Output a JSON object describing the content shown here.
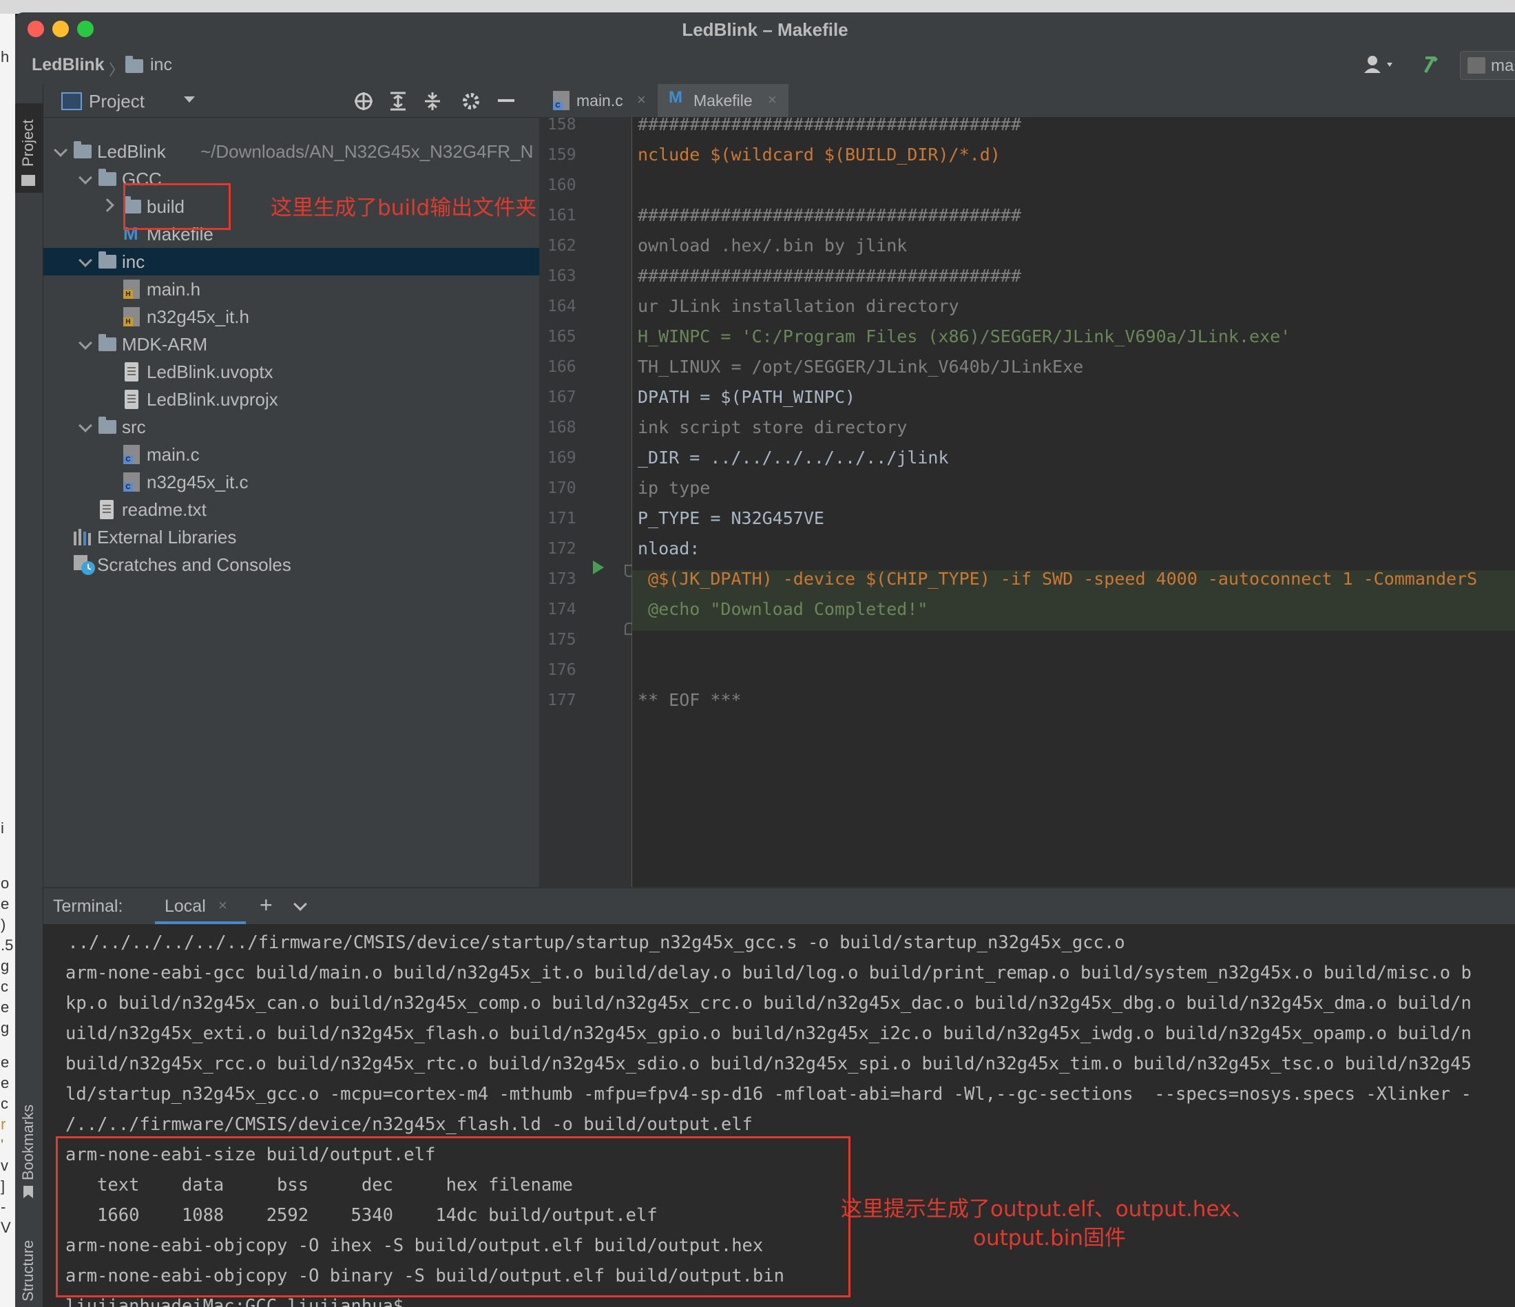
{
  "window": {
    "title": "LedBlink – Makefile",
    "breadcrumb_project": "LedBlink",
    "breadcrumb_folder": "inc",
    "right_button_partial": "ma"
  },
  "side_tabs": {
    "project": "Project",
    "bookmarks": "Bookmarks",
    "structure": "Structure"
  },
  "project_panel": {
    "title": "Project",
    "tree": [
      {
        "label": "LedBlink",
        "path": "~/Downloads/AN_N32G45x_N32G4FR_N"
      },
      {
        "label": "GCC"
      },
      {
        "label": "build"
      },
      {
        "label": "Makefile"
      },
      {
        "label": "inc"
      },
      {
        "label": "main.h"
      },
      {
        "label": "n32g45x_it.h"
      },
      {
        "label": "MDK-ARM"
      },
      {
        "label": "LedBlink.uvoptx"
      },
      {
        "label": "LedBlink.uvprojx"
      },
      {
        "label": "src"
      },
      {
        "label": "main.c"
      },
      {
        "label": "n32g45x_it.c"
      },
      {
        "label": "readme.txt"
      },
      {
        "label": "External Libraries"
      },
      {
        "label": "Scratches and Consoles"
      }
    ]
  },
  "editor": {
    "tabs": [
      {
        "label": "main.c"
      },
      {
        "label": "Makefile"
      }
    ],
    "line_numbers": [
      "158",
      "159",
      "160",
      "161",
      "162",
      "163",
      "164",
      "165",
      "166",
      "167",
      "168",
      "169",
      "170",
      "171",
      "172",
      "173",
      "174",
      "175",
      "176",
      "177"
    ],
    "lines": [
      "#####################################",
      "nclude $(wildcard $(BUILD_DIR)/*.d)",
      "",
      "#####################################",
      "ownload .hex/.bin by jlink",
      "#####################################",
      "ur JLink installation directory",
      "H_WINPC = 'C:/Program Files (x86)/SEGGER/JLink_V690a/JLink.exe'",
      "TH_LINUX = /opt/SEGGER/JLink_V640b/JLinkExe",
      "DPATH = $(PATH_WINPC)",
      "ink script store directory",
      "_DIR = ../../../../../../jlink",
      "ip type",
      "P_TYPE = N32G457VE",
      "nload:",
      " @$(JK_DPATH) -device $(CHIP_TYPE) -if SWD -speed 4000 -autoconnect 1 -CommanderS",
      " @echo \"Download Completed!\"",
      "",
      "",
      "** EOF ***"
    ]
  },
  "terminal": {
    "label": "Terminal:",
    "tab": "Local",
    "lines": [
      " ../../../../../../firmware/CMSIS/device/startup/startup_n32g45x_gcc.s -o build/startup_n32g45x_gcc.o",
      "arm-none-eabi-gcc build/main.o build/n32g45x_it.o build/delay.o build/log.o build/print_remap.o build/system_n32g45x.o build/misc.o b",
      "kp.o build/n32g45x_can.o build/n32g45x_comp.o build/n32g45x_crc.o build/n32g45x_dac.o build/n32g45x_dbg.o build/n32g45x_dma.o build/n",
      "uild/n32g45x_exti.o build/n32g45x_flash.o build/n32g45x_gpio.o build/n32g45x_i2c.o build/n32g45x_iwdg.o build/n32g45x_opamp.o build/n",
      "build/n32g45x_rcc.o build/n32g45x_rtc.o build/n32g45x_sdio.o build/n32g45x_spi.o build/n32g45x_tim.o build/n32g45x_tsc.o build/n32g45",
      "ld/startup_n32g45x_gcc.o -mcpu=cortex-m4 -mthumb -mfpu=fpv4-sp-d16 -mfloat-abi=hard -Wl,--gc-sections  --specs=nosys.specs -Xlinker -",
      "/../../firmware/CMSIS/device/n32g45x_flash.ld -o build/output.elf",
      "arm-none-eabi-size build/output.elf",
      "   text    data     bss     dec     hex filename",
      "   1660    1088    2592    5340    14dc build/output.elf",
      "arm-none-eabi-objcopy -O ihex -S build/output.elf build/output.hex",
      "arm-none-eabi-objcopy -O binary -S build/output.elf build/output.bin",
      "liujianhuadeiMac:GCC liujianhua$"
    ]
  },
  "annotations": {
    "build_note": "这里生成了build输出文件夹",
    "output_note_1": "这里提示生成了output.elf、output.hex、",
    "output_note_2": "output.bin固件"
  },
  "left_sliver_chars": [
    "h",
    "i",
    "o",
    "e",
    ")",
    ".5",
    "g",
    "c",
    "e",
    "g",
    "e",
    "e",
    "c",
    "r",
    "'",
    "v",
    "]",
    "-",
    "V"
  ],
  "colors": {
    "accent": "#4a88c7",
    "annotation_red": "#e03a2f",
    "run_green": "#499c54"
  }
}
